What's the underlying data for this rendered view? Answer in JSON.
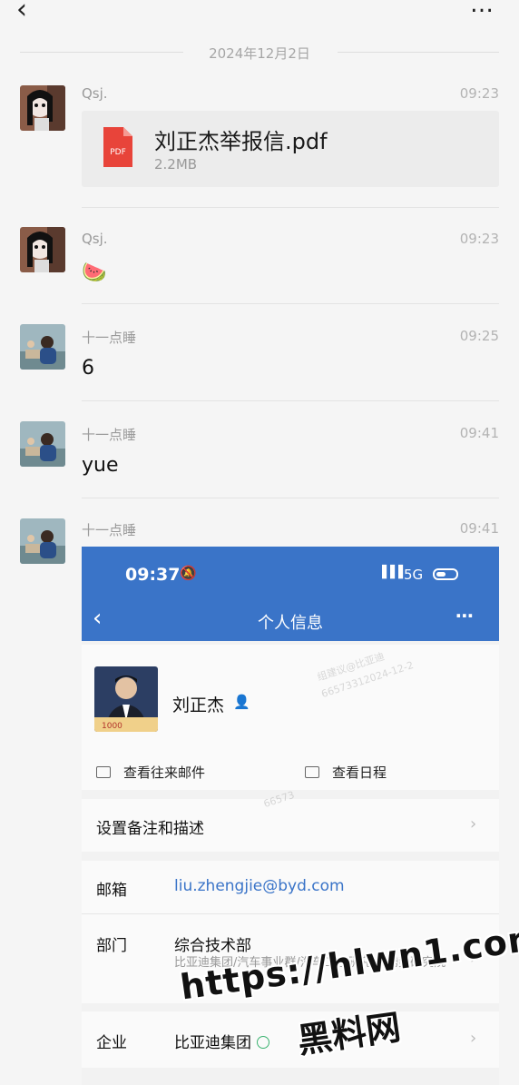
{
  "header": {
    "back_icon": "chevron-left-icon",
    "more_icon": "more-horizontal-icon"
  },
  "date_separator": "2024年12月2日",
  "messages": [
    {
      "sender": "Qsj.",
      "time": "09:23",
      "type": "file",
      "file_name": "刘正杰举报信.pdf",
      "file_size": "2.2MB",
      "file_icon_text": "PDF"
    },
    {
      "sender": "Qsj.",
      "time": "09:23",
      "type": "emoji",
      "text": "🍉"
    },
    {
      "sender": "十一点睡",
      "time": "09:25",
      "type": "text",
      "text": "6"
    },
    {
      "sender": "十一点睡",
      "time": "09:41",
      "type": "text",
      "text": "yue"
    },
    {
      "sender": "十一点睡",
      "time": "09:41",
      "type": "image"
    }
  ],
  "embedded_screenshot": {
    "status_time": "09:37",
    "network": "5G",
    "title": "个人信息",
    "profile_name": "刘正杰",
    "action_mail": "查看往来邮件",
    "action_calendar": "查看日程",
    "remark_label": "设置备注和描述",
    "email_label": "邮箱",
    "email_value": "liu.zhengjie@byd.com",
    "email_color": "#3a74c8",
    "dept_label": "部门",
    "dept_value": "综合技术部",
    "dept_path": "比亚迪集团/汽车事业群/汽车工程研究院/腾势研究院",
    "company_label": "企业",
    "company_value": "比亚迪集团",
    "watermarks": [
      "组建议@比亚迪",
      "66573312024-12-2",
      "66573"
    ],
    "header_color": "#3a74c8"
  },
  "overlay_watermark": {
    "url": "https://hlwn1.com",
    "text": "黑料网"
  }
}
